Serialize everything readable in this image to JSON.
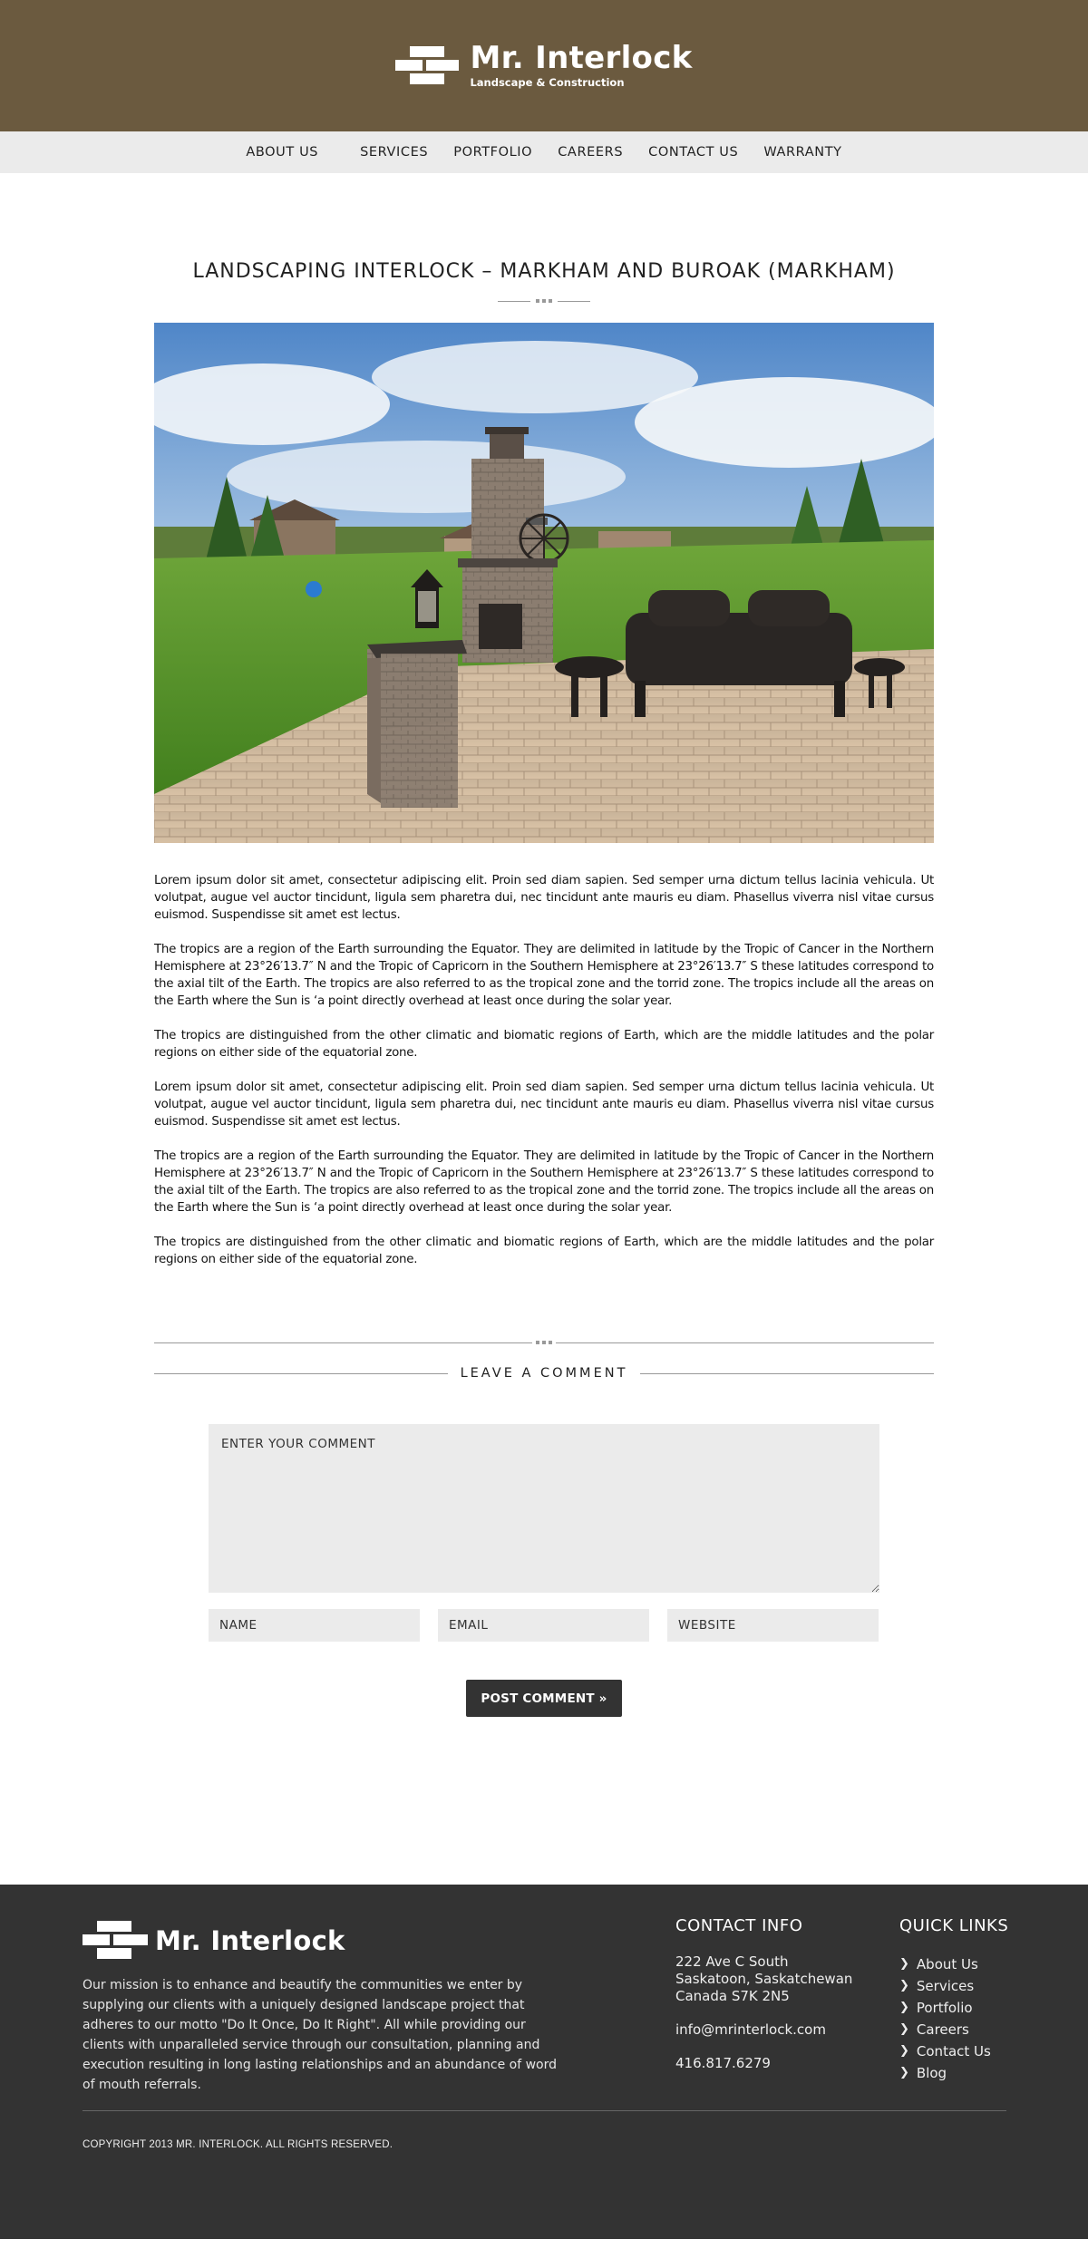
{
  "brand": {
    "title": "Mr. Interlock",
    "subtitle": "Landscape & Construction",
    "icon": "bricks-logo-icon"
  },
  "nav": {
    "items": [
      "ABOUT US",
      "SERVICES",
      "PORTFOLIO",
      "CAREERS",
      "CONTACT US",
      "WARRANTY"
    ]
  },
  "page": {
    "title": "LANDSCAPING INTERLOCK – MARKHAM AND BUROAK (MARKHAM)",
    "hero_alt": "Backyard interlock patio with stone fireplace, wicker furniture and lawn",
    "paragraphs": [
      "Lorem ipsum dolor sit amet, consectetur adipiscing elit. Proin sed diam sapien. Sed semper urna dictum tellus lacinia vehicula. Ut volutpat, augue vel auctor tincidunt, ligula sem pharetra dui, nec tincidunt ante mauris eu diam. Phasellus viverra nisl vitae cursus euismod. Suspendisse sit amet est lectus.",
      "The tropics are a region of the Earth surrounding the Equator. They are delimited in latitude by the Tropic of Cancer in the Northern Hemisphere at 23°26′13.7″ N and the Tropic of Capricorn in the Southern Hemisphere at 23°26′13.7″ S these latitudes correspond to the axial tilt of the Earth. The tropics are also referred to as the tropical zone and the torrid zone. The tropics include all the areas on the Earth where the Sun is ‘a point directly overhead at least once during the solar year.",
      "The tropics are distinguished from the other climatic and biomatic regions of Earth, which are the middle latitudes and the polar regions on either side of the equatorial zone.",
      "Lorem ipsum dolor sit amet, consectetur adipiscing elit. Proin sed diam sapien. Sed semper urna dictum tellus lacinia vehicula. Ut volutpat, augue vel auctor tincidunt, ligula sem pharetra dui, nec tincidunt ante mauris eu diam. Phasellus viverra nisl vitae cursus euismod. Suspendisse sit amet est lectus.",
      "The tropics are a region of the Earth surrounding the Equator. They are delimited in latitude by the Tropic of Cancer in the Northern Hemisphere at 23°26′13.7″ N and the Tropic of Capricorn in the Southern Hemisphere at 23°26′13.7″ S these latitudes correspond to the axial tilt of the Earth. The tropics are also referred to as the tropical zone and the torrid zone. The tropics include all the areas on the Earth where the Sun is ‘a point directly overhead at least once during the solar year.",
      "The tropics are distinguished from the other climatic and biomatic regions of Earth, which are the middle latitudes and the polar regions on either side of the equatorial zone."
    ]
  },
  "comment": {
    "heading": "LEAVE A COMMENT",
    "comment_placeholder": "ENTER YOUR COMMENT",
    "name_placeholder": "NAME",
    "email_placeholder": "EMAIL",
    "website_placeholder": "WEBSITE",
    "submit_label": "POST COMMENT »"
  },
  "footer": {
    "brand": "Mr. Interlock",
    "mission": "Our mission is to enhance and beautify the communities we enter by supplying our clients with a uniquely designed landscape project that adheres to our motto \"Do It Once, Do It Right\". All while providing our clients with unparalleled service through our consultation, planning and execution resulting in long lasting relationships and an abundance of word of mouth referrals.",
    "contact_heading": "CONTACT INFO",
    "address_line1": "222 Ave C South",
    "address_line2": "Saskatoon, Saskatchewan",
    "address_line3": "Canada S7K 2N5",
    "email": "info@mrinterlock.com",
    "phone": "416.817.6279",
    "links_heading": "QUICK LINKS",
    "links": [
      "About Us",
      "Services",
      "Portfolio",
      "Careers",
      "Contact Us",
      "Blog"
    ],
    "copyright": "COPYRIGHT 2013 MR. INTERLOCK. ALL RIGHTS RESERVED."
  },
  "colors": {
    "header_bg": "#6b5a3f",
    "nav_bg": "#ebebeb",
    "footer_bg": "#333333",
    "button_bg": "#333333"
  }
}
